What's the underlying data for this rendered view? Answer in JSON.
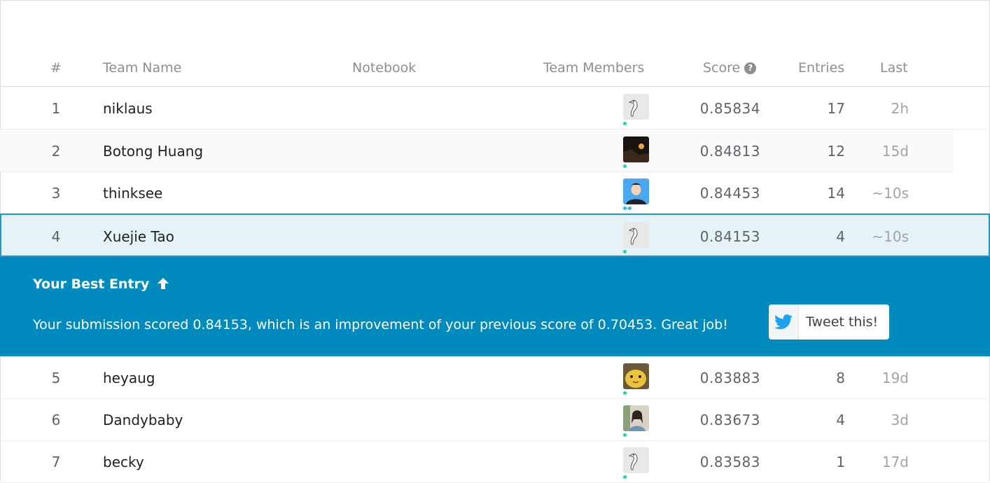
{
  "header": {
    "rank": "#",
    "team_name": "Team Name",
    "notebook": "Notebook",
    "team_members": "Team Members",
    "score": "Score",
    "entries": "Entries",
    "last": "Last"
  },
  "rows_top": [
    {
      "rank": "1",
      "name": "niklaus",
      "avatar": "goose-avatar-icon",
      "score": "0.85834",
      "entries": "17",
      "last": "2h"
    },
    {
      "rank": "2",
      "name": "Botong Huang",
      "avatar": "dark-photo-avatar-icon",
      "score": "0.84813",
      "entries": "12",
      "last": "15d"
    },
    {
      "rank": "3",
      "name": "thinksee",
      "avatar": "portrait-avatar-icon",
      "score": "0.84453",
      "entries": "14",
      "last": "~10s"
    }
  ],
  "my_row": {
    "rank": "4",
    "name": "Xuejie Tao",
    "avatar": "goose-avatar-icon",
    "score": "0.84153",
    "entries": "4",
    "last": "~10s"
  },
  "banner": {
    "title": "Your Best Entry",
    "message": "Your submission scored 0.84153, which is an improvement of your previous score of 0.70453. Great job!",
    "tweet_label": "Tweet this!"
  },
  "rows_bottom": [
    {
      "rank": "5",
      "name": "heyaug",
      "avatar": "yellow-toy-avatar-icon",
      "score": "0.83883",
      "entries": "8",
      "last": "19d"
    },
    {
      "rank": "6",
      "name": "Dandybaby",
      "avatar": "girl-photo-avatar-icon",
      "score": "0.83673",
      "entries": "4",
      "last": "3d"
    },
    {
      "rank": "7",
      "name": "becky",
      "avatar": "goose-avatar-icon",
      "score": "0.83583",
      "entries": "1",
      "last": "17d"
    }
  ],
  "colors": {
    "banner": "#008abd",
    "highlight": "#e5f2f8",
    "highlight_border": "#2596c9",
    "twitter": "#1da1f2"
  }
}
